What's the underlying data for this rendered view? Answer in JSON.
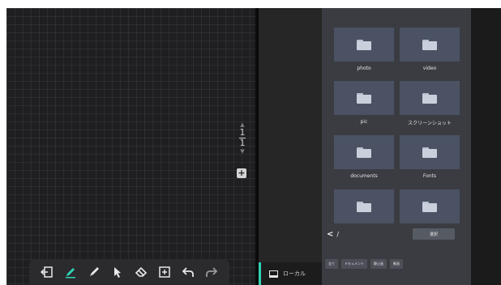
{
  "board": {
    "page_current": "1",
    "page_total": "1",
    "add_page_label": "+"
  },
  "toolbar": {
    "tools": [
      "exit-icon",
      "pen-icon",
      "highlighter-icon",
      "pointer-icon",
      "eraser-icon",
      "add-box-icon",
      "undo-icon",
      "redo-icon"
    ],
    "accent": "#2fd3b3"
  },
  "sidebar": {
    "local_label": "ローカル"
  },
  "files": {
    "folders": [
      {
        "name": "photo"
      },
      {
        "name": "video"
      },
      {
        "name": "pic"
      },
      {
        "name": "スクリーンショット"
      },
      {
        "name": "documents"
      },
      {
        "name": "Fonts"
      },
      {
        "name": ""
      },
      {
        "name": ""
      }
    ],
    "path": "/",
    "select_label": "選択",
    "filters": [
      "全て",
      "ドキュメント",
      "静止画",
      "動画"
    ]
  }
}
